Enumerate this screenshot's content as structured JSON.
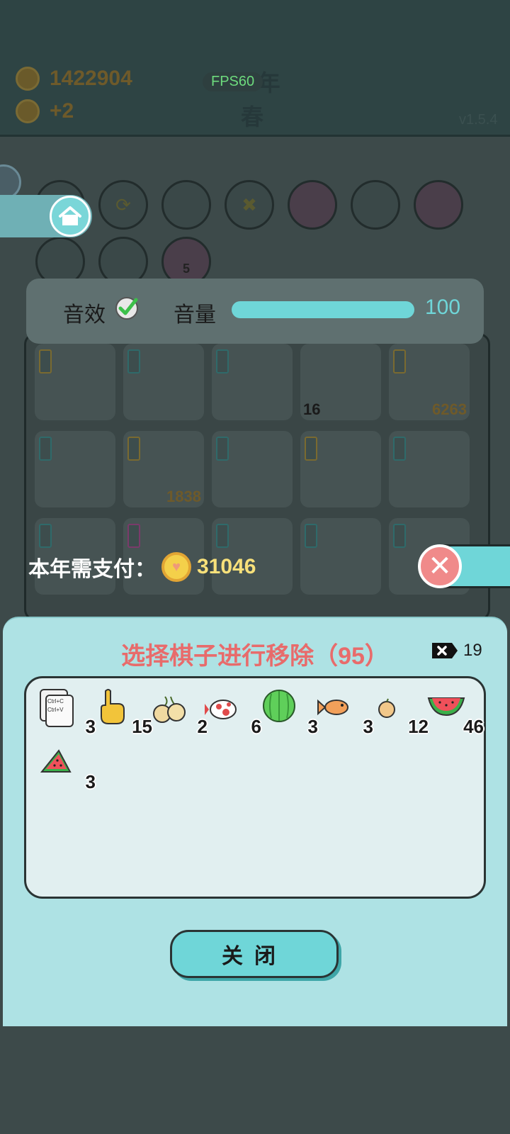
{
  "header": {
    "coins": "1422904",
    "coin_income": "+2",
    "year": "90年",
    "season": "春",
    "fps": "FPS60",
    "version": "v1.5.4"
  },
  "board": {
    "counts": [
      "16",
      "6263",
      "1838"
    ]
  },
  "calendar_day": "5",
  "settings": {
    "sound_effect_label": "音效",
    "volume_label": "音量",
    "volume_value": "100",
    "volume_fraction": 1.0,
    "sound_effect_enabled": true
  },
  "payment": {
    "label": "本年需支付：",
    "amount": "31046"
  },
  "dialog": {
    "title": "选择棋子进行移除（95）",
    "removal_tokens": "19",
    "items": [
      {
        "icon": "ctrl-cv-card-icon",
        "count": "3",
        "card_text_1": "Ctrl+C",
        "card_text_2": "Ctrl+V"
      },
      {
        "icon": "pointing-hand-icon",
        "count": "15"
      },
      {
        "icon": "longan-icon",
        "count": "2"
      },
      {
        "icon": "koi-fish-icon",
        "count": "6"
      },
      {
        "icon": "watermelon-whole-icon",
        "count": "3"
      },
      {
        "icon": "fish-icon",
        "count": "3"
      },
      {
        "icon": "small-fruit-icon",
        "count": "12"
      },
      {
        "icon": "watermelon-slice-icon",
        "count": "46"
      },
      {
        "icon": "watermelon-wedge-icon",
        "count": "3"
      }
    ],
    "close_label": "关闭"
  },
  "colors": {
    "accent_teal": "#6fd6d8",
    "title_red": "#e86b6b",
    "dialog_bg": "#aee2e4",
    "coin_gold": "#f4d04a"
  }
}
